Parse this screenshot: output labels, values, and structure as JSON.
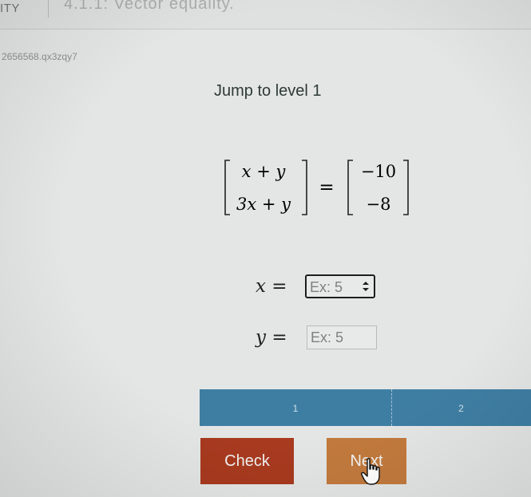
{
  "header": {
    "left_label": "ITY",
    "activity_title": "4.1.1: Vector equality."
  },
  "activity_code": "2656568.qx3zqy7",
  "level_title": "Jump to level 1",
  "equation": {
    "lhs": [
      [
        "x + y"
      ],
      [
        "3x + y"
      ]
    ],
    "rhs": [
      [
        "−10"
      ],
      [
        "−8"
      ]
    ],
    "equals": "="
  },
  "answers": [
    {
      "variable": "x",
      "equals": "=",
      "placeholder": "Ex: 5",
      "focused": true
    },
    {
      "variable": "y",
      "equals": "=",
      "placeholder": "Ex: 5",
      "focused": false
    }
  ],
  "progress": {
    "segments": [
      "1",
      "2"
    ],
    "bar_color": "#3f7ea3"
  },
  "buttons": {
    "check_label": "Check",
    "next_label": "Next",
    "check_color": "#a83a1f",
    "next_color": "#c27a3d"
  },
  "icons": {
    "cursor": "hand-pointer-icon",
    "spinner": "up-down-spinner-icon"
  }
}
